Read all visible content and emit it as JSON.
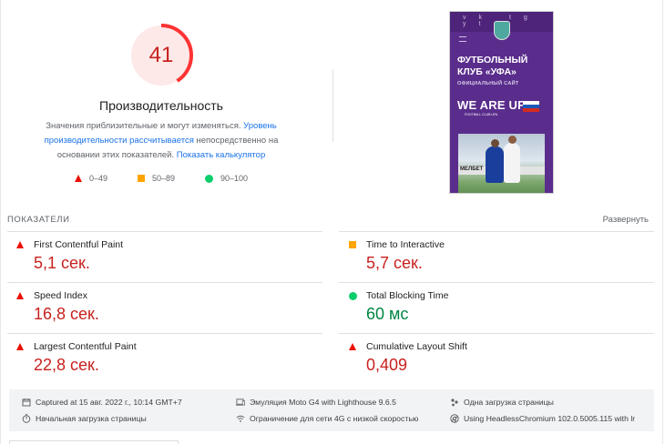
{
  "gauge": {
    "score": "41",
    "score_fraction": 0.41,
    "color": "#ff3333"
  },
  "performance": {
    "title": "Производительность",
    "desc_1": "Значения приблизительные и могут изменяться.",
    "desc_link_1": "Уровень производительности рассчитывается",
    "desc_2": "непосредственно на основании этих показателей.",
    "desc_link_2": "Показать калькулятор"
  },
  "legend": [
    {
      "label": "0–49",
      "icon": "red-triangle-icon"
    },
    {
      "label": "50–89",
      "icon": "orange-square-icon"
    },
    {
      "label": "90–100",
      "icon": "green-circle-icon"
    }
  ],
  "preview": {
    "social": "vk tg yt",
    "title_line1": "ФУТБОЛЬНЫЙ",
    "title_line2": "КЛУБ «УФА»",
    "subtitle": "ОФИЦИАЛЬНЫЙ САЙТ",
    "slogan": "WE ARE UFA",
    "slogan_sub": "FOOTBALL CLUB UFA",
    "banner": "МЕЛБЕТ"
  },
  "metrics": {
    "title": "ПОКАЗАТЕЛИ",
    "expand_label": "Развернуть",
    "items": [
      {
        "name": "First Contentful Paint",
        "value": "5,1 сек.",
        "status": "fail"
      },
      {
        "name": "Time to Interactive",
        "value": "5,7 сек.",
        "status": "average"
      },
      {
        "name": "Speed Index",
        "value": "16,8 сек.",
        "status": "fail"
      },
      {
        "name": "Total Blocking Time",
        "value": "60 мс",
        "status": "pass"
      },
      {
        "name": "Largest Contentful Paint",
        "value": "22,8 сек.",
        "status": "fail"
      },
      {
        "name": "Cumulative Layout Shift",
        "value": "0,409",
        "status": "fail"
      }
    ]
  },
  "footer": {
    "captured": "Captured at 15 авг. 2022 г., 10:14 GMT+7",
    "emulation": "Эмуляция Moto G4 with Lighthouse 9.6.5",
    "single_load": "Одна загрузка страницы",
    "initial_load": "Начальная загрузка страницы",
    "network": "Ограничение для сети 4G с низкой скоростью",
    "browser": "Using HeadlessChromium 102.0.5005.115 with lr"
  },
  "colors": {
    "fail": "#eb0f00",
    "average": "#ffa400",
    "pass": "#0cce6b",
    "fail_text": "#c7221f",
    "pass_text": "#018642"
  }
}
